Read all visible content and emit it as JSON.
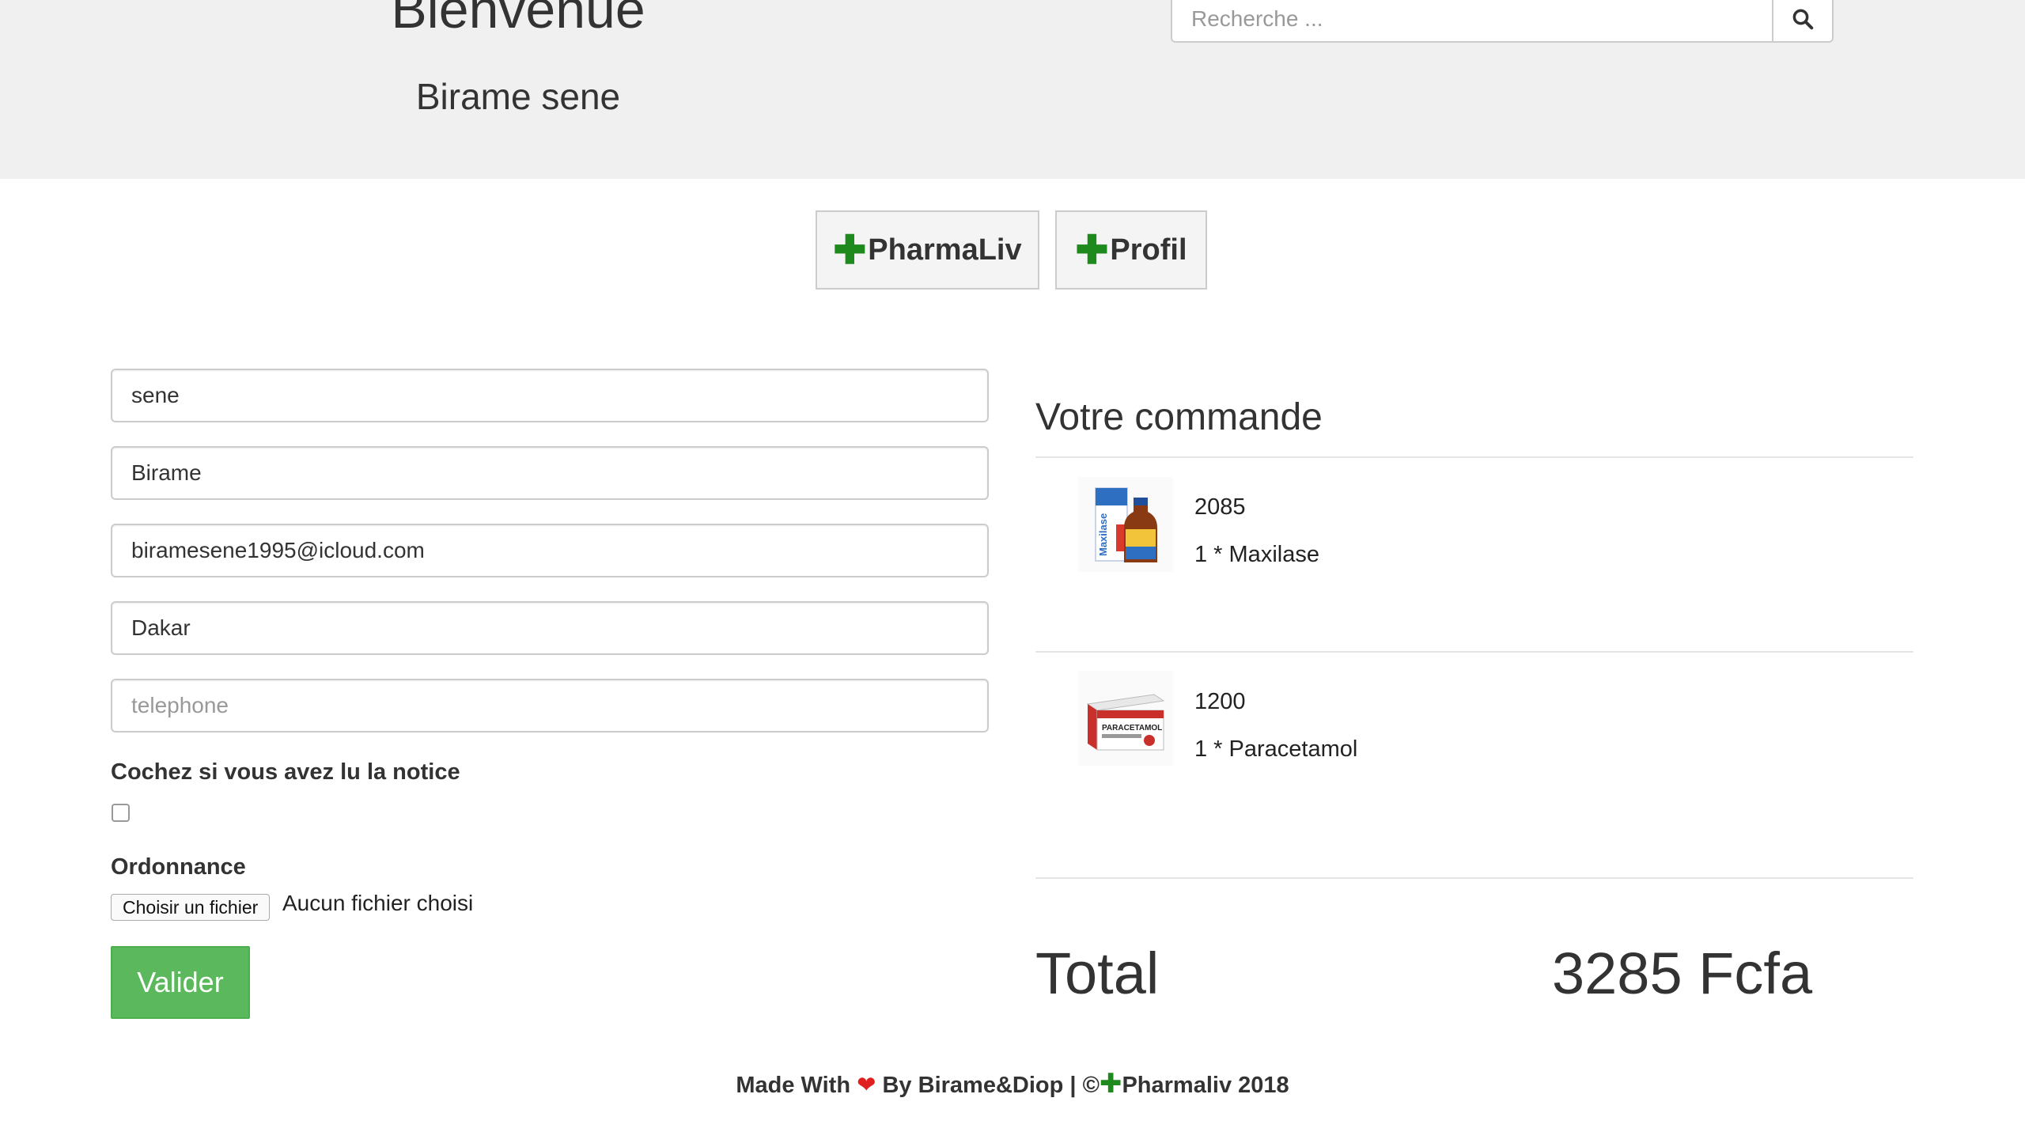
{
  "header": {
    "welcome": "Bienvenue",
    "username": "Birame sene",
    "search_placeholder": "Recherche ..."
  },
  "nav": {
    "pharmaliv": "PharmaLiv",
    "profil": "Profil"
  },
  "form": {
    "nom": "sene",
    "prenom": "Birame",
    "email": "biramesene1995@icloud.com",
    "ville": "Dakar",
    "telephone_placeholder": "telephone",
    "notice_label": "Cochez si vous avez lu la notice",
    "notice_checked": false,
    "ordonnance_label": "Ordonnance",
    "file_button": "Choisir un fichier",
    "file_status": "Aucun fichier choisi",
    "submit": "Valider"
  },
  "order": {
    "title": "Votre commande",
    "items": [
      {
        "price": "2085",
        "line": "1 * Maxilase",
        "image": "maxilase-product-image"
      },
      {
        "price": "1200",
        "line": "1 * Paracetamol",
        "image": "paracetamol-product-image"
      }
    ],
    "total_label": "Total",
    "total_value": "3285 Fcfa"
  },
  "footer": {
    "made_with": "Made With",
    "by": "By",
    "authors": "Birame&Diop",
    "separator": "|",
    "copyright": "©",
    "brand": "Pharmaliv",
    "year": "2018"
  },
  "colors": {
    "header_bg": "#f0f0f0",
    "brand_green": "#1e8a1e",
    "submit_green": "#5cb85c",
    "heart_red": "#e02020"
  }
}
